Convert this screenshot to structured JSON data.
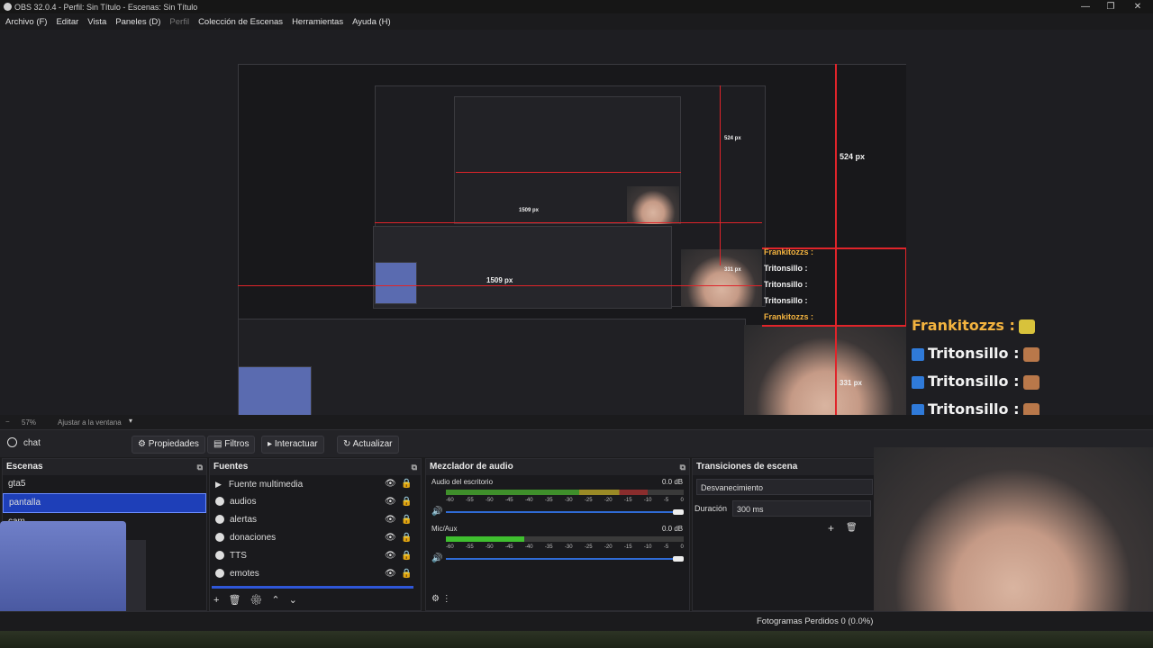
{
  "window": {
    "title": "OBS 32.0.4 - Perfil: Sin Título - Escenas: Sin Título",
    "minimize": "—",
    "restore": "❐",
    "close": "✕"
  },
  "menu": [
    "Archivo (F)",
    "Editar",
    "Vista",
    "Paneles (D)",
    "Perfil",
    "Colección de Escenas",
    "Herramientas",
    "Ayuda (H)"
  ],
  "preview": {
    "measure_top": "524 px",
    "measure_mid": "1509 px",
    "measure_right": "331 px",
    "measure_top_small": "524 px",
    "measure_mid_small": "1509 px",
    "measure_right_small": "331 px"
  },
  "chat": [
    {
      "user": "Frankitozzs",
      "sep": ":",
      "color": "#f3b33f",
      "twitch": false
    },
    {
      "user": "Tritonsillo",
      "sep": ":",
      "color": "#f2f2f2",
      "twitch": true
    },
    {
      "user": "Tritonsillo",
      "sep": ":",
      "color": "#f2f2f2",
      "twitch": true
    },
    {
      "user": "Tritonsillo",
      "sep": ":",
      "color": "#f2f2f2",
      "twitch": true
    },
    {
      "user": "Frankitozzs",
      "sep": ":",
      "color": "#f3b33f",
      "twitch": false
    }
  ],
  "zoom": {
    "level": "57%",
    "fit": "Ajustar a la ventana"
  },
  "source_toolbar": {
    "name": "chat",
    "props": "Propiedades",
    "filters": "Filtros",
    "interact": "Interactuar",
    "refresh": "Actualizar"
  },
  "scenes": {
    "title": "Escenas",
    "items": [
      "gta5",
      "pantalla",
      "cam"
    ],
    "selected": 1
  },
  "sources": {
    "title": "Fuentes",
    "items": [
      "Fuente multimedia",
      "audios",
      "alertas",
      "donaciones",
      "TTS",
      "emotes"
    ]
  },
  "mixer": {
    "title": "Mezclador de audio",
    "channels": [
      {
        "name": "Audio del escritorio",
        "db": "0.0 dB",
        "level": 0.85
      },
      {
        "name": "Mic/Aux",
        "db": "0.0 dB",
        "level": 0.33
      }
    ],
    "scale": [
      "-60",
      "-55",
      "-50",
      "-45",
      "-40",
      "-35",
      "-30",
      "-25",
      "-20",
      "-15",
      "-10",
      "-5",
      "0"
    ]
  },
  "transitions": {
    "title": "Transiciones de escena",
    "type": "Desvanecimiento",
    "duration_label": "Duración",
    "duration": "300 ms"
  },
  "status": {
    "frames": "Fotogramas Perdidos 0 (0.0%)"
  }
}
